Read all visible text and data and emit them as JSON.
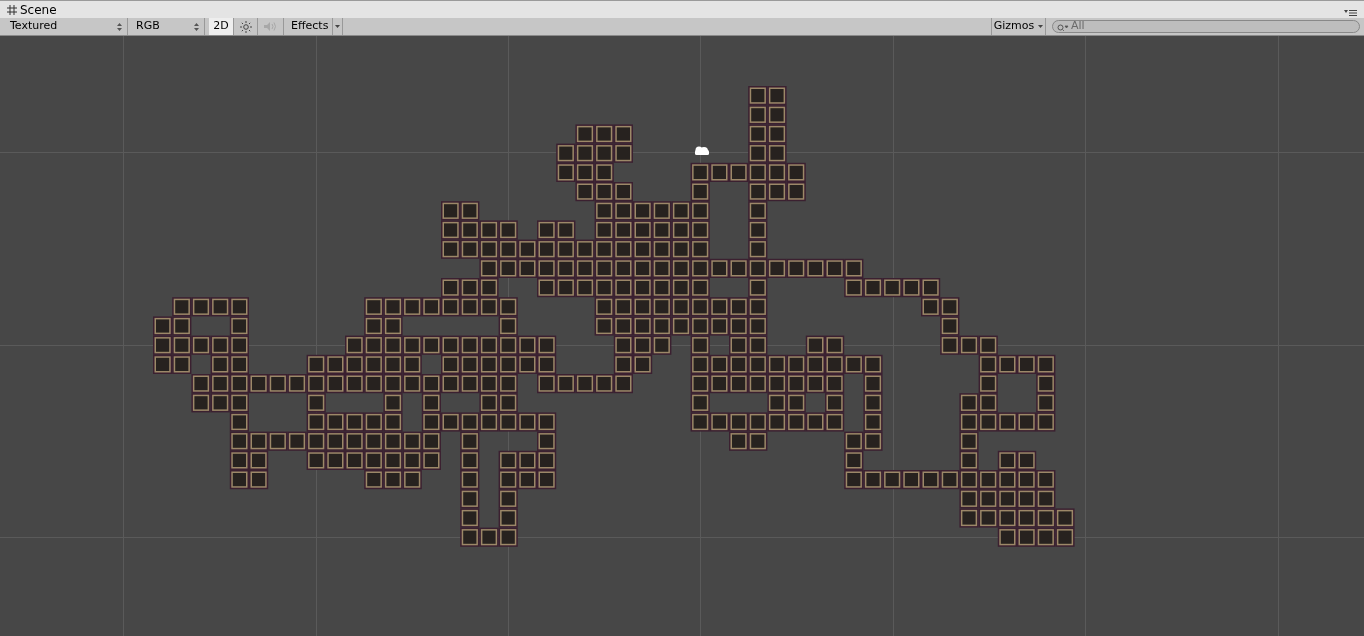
{
  "tab": {
    "title": "Scene"
  },
  "toolbar": {
    "draw_mode": "Textured",
    "render_mode": "RGB",
    "mode_2d": {
      "label": "2D",
      "selected": true
    },
    "lighting": {
      "selected": false
    },
    "audio": {
      "disabled": true
    },
    "effects": "Effects",
    "gizmos": "Gizmos",
    "search": {
      "placeholder": "All"
    }
  }
}
